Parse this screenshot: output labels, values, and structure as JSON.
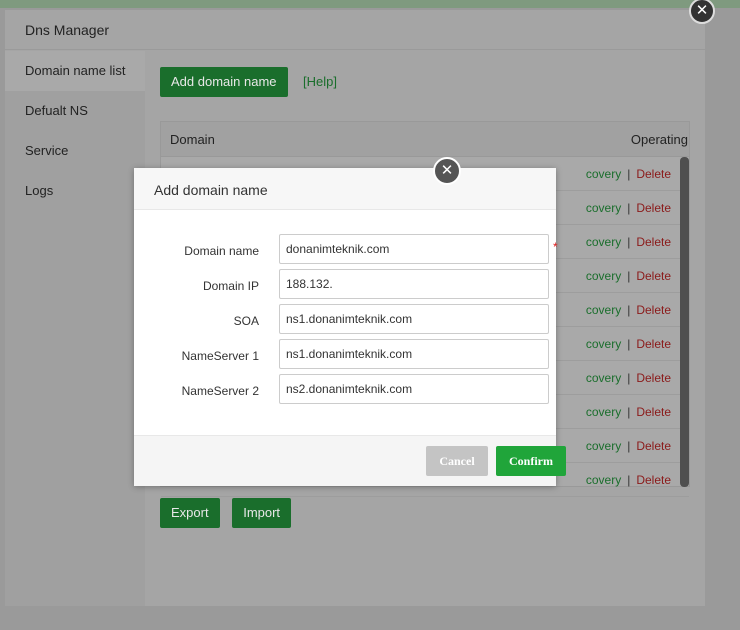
{
  "window": {
    "title": "Dns Manager",
    "close_icon": "close-icon"
  },
  "sidebar": {
    "items": [
      {
        "label": "Domain name list"
      },
      {
        "label": "Defualt NS"
      },
      {
        "label": "Service"
      },
      {
        "label": "Logs"
      }
    ]
  },
  "content": {
    "add_button": "Add domain name",
    "help_link": "[Help]",
    "table": {
      "col_domain": "Domain",
      "col_operating": "Operating",
      "rows": [
        {
          "recovery": "covery",
          "sep": "|",
          "delete": "Delete"
        },
        {
          "recovery": "covery",
          "sep": "|",
          "delete": "Delete"
        },
        {
          "recovery": "covery",
          "sep": "|",
          "delete": "Delete"
        },
        {
          "recovery": "covery",
          "sep": "|",
          "delete": "Delete"
        },
        {
          "recovery": "covery",
          "sep": "|",
          "delete": "Delete"
        },
        {
          "recovery": "covery",
          "sep": "|",
          "delete": "Delete"
        },
        {
          "recovery": "covery",
          "sep": "|",
          "delete": "Delete"
        },
        {
          "recovery": "covery",
          "sep": "|",
          "delete": "Delete"
        },
        {
          "recovery": "covery",
          "sep": "|",
          "delete": "Delete"
        },
        {
          "recovery": "covery",
          "sep": "|",
          "delete": "Delete"
        }
      ]
    },
    "export_button": "Export",
    "import_button": "Import"
  },
  "modal": {
    "title": "Add domain name",
    "close_icon": "close-icon",
    "fields": {
      "domain_name": {
        "label": "Domain name",
        "value": "donanimteknik.com",
        "required": "*"
      },
      "domain_ip": {
        "label": "Domain IP",
        "value": "188.132."
      },
      "soa": {
        "label": "SOA",
        "value": "ns1.donanimteknik.com"
      },
      "nameserver1": {
        "label": "NameServer 1",
        "value": "ns1.donanimteknik.com"
      },
      "nameserver2": {
        "label": "NameServer 2",
        "value": "ns2.donanimteknik.com"
      }
    },
    "cancel_button": "Cancel",
    "confirm_button": "Confirm"
  },
  "colors": {
    "accent": "#20a53a",
    "danger": "#e02020"
  }
}
